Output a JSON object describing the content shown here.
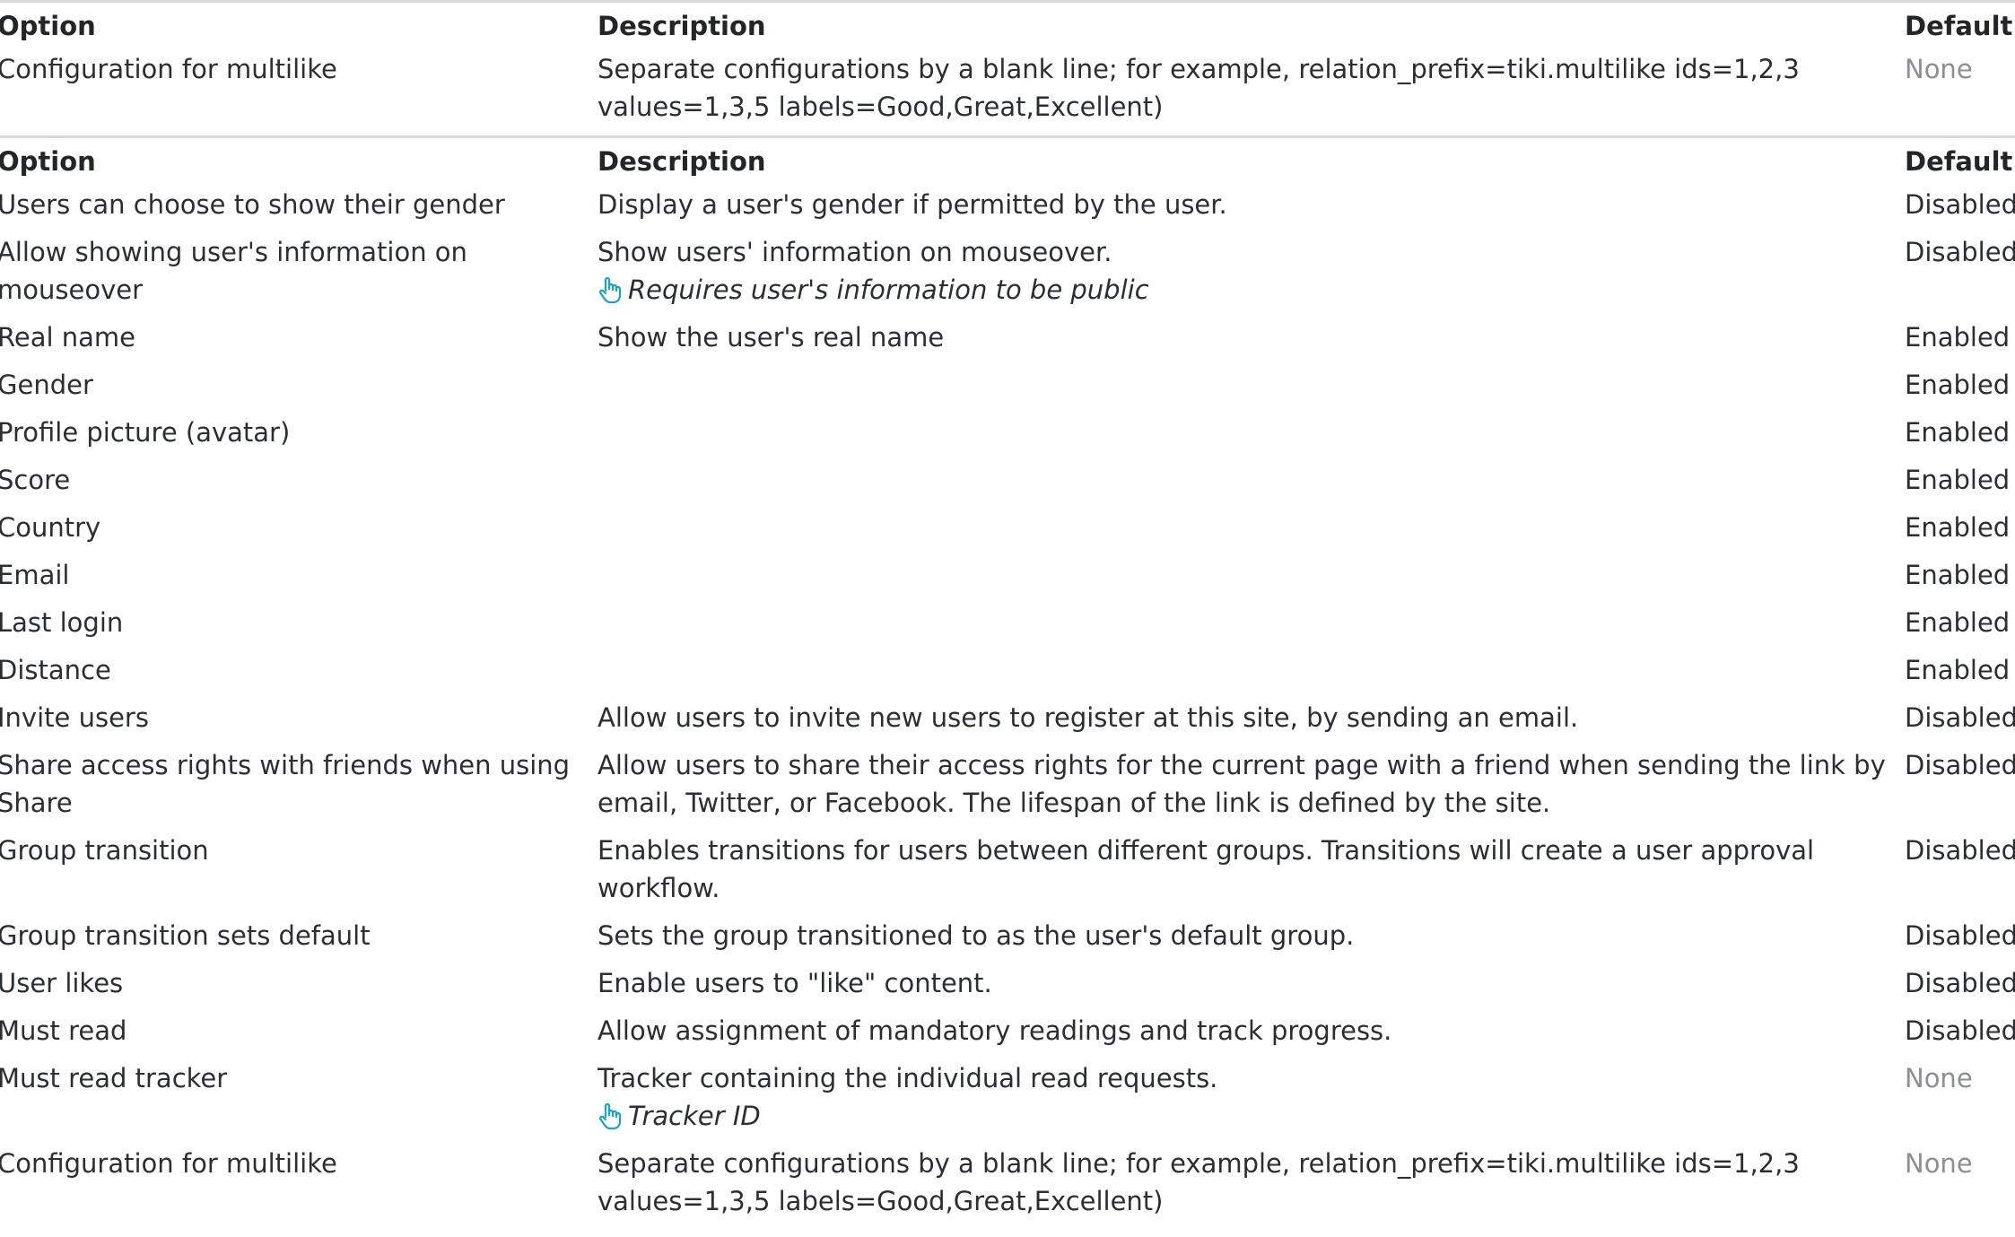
{
  "headers": {
    "option": "Option",
    "description": "Description",
    "default": "Default"
  },
  "top_table": {
    "rows": [
      {
        "option": "Configuration for multilike",
        "description": "Separate configurations by a blank line; for example, relation_prefix=tiki.multilike ids=1,2,3 values=1,3,5 labels=Good,Great,Excellent)",
        "default": "None"
      }
    ]
  },
  "main_table": {
    "rows": [
      {
        "option": "Users can choose to show their gender",
        "description": "Display a user's gender if permitted by the user.",
        "default": "Disabled"
      },
      {
        "option": "Allow showing user's information on mouseover",
        "description": "Show users' information on mouseover.",
        "hint": "Requires user's information to be public",
        "default": "Disabled"
      },
      {
        "option": "Real name",
        "description": "Show the user's real name",
        "default": "Enabled"
      },
      {
        "option": "Gender",
        "description": "",
        "default": "Enabled"
      },
      {
        "option": "Profile picture (avatar)",
        "description": "",
        "default": "Enabled"
      },
      {
        "option": "Score",
        "description": "",
        "default": "Enabled"
      },
      {
        "option": "Country",
        "description": "",
        "default": "Enabled"
      },
      {
        "option": "Email",
        "description": "",
        "default": "Enabled"
      },
      {
        "option": "Last login",
        "description": "",
        "default": "Enabled"
      },
      {
        "option": "Distance",
        "description": "",
        "default": "Enabled"
      },
      {
        "option": "Invite users",
        "description": "Allow users to invite new users to register at this site, by sending an email.",
        "default": "Disabled"
      },
      {
        "option": "Share access rights with friends when using Share",
        "description": "Allow users to share their access rights for the current page with a friend when sending the link by email, Twitter, or Facebook. The lifespan of the link is defined by the site.",
        "default": "Disabled"
      },
      {
        "option": "Group transition",
        "description": "Enables transitions for users between different groups. Transitions will create a user approval workflow.",
        "default": "Disabled"
      },
      {
        "option": "Group transition sets default",
        "description": "Sets the group transitioned to as the user's default group.",
        "default": "Disabled"
      },
      {
        "option": "User likes",
        "description": "Enable users to \"like\" content.",
        "default": "Disabled"
      },
      {
        "option": "Must read",
        "description": "Allow assignment of mandatory readings and track progress.",
        "default": "Disabled"
      },
      {
        "option": "Must read tracker",
        "description": "Tracker containing the individual read requests.",
        "hint": "Tracker ID",
        "default": "None"
      },
      {
        "option": "Configuration for multilike",
        "description": "Separate configurations by a blank line; for example, relation_prefix=tiki.multilike ids=1,2,3 values=1,3,5 labels=Good,Great,Excellent)",
        "default": "None"
      }
    ]
  },
  "colors": {
    "text": "#2a2f33",
    "muted": "#8a8f93",
    "hint_icon": "#1aa3c8",
    "rule": "#d9d9d9"
  },
  "icons": {
    "hint": "pointing-hand-icon"
  }
}
